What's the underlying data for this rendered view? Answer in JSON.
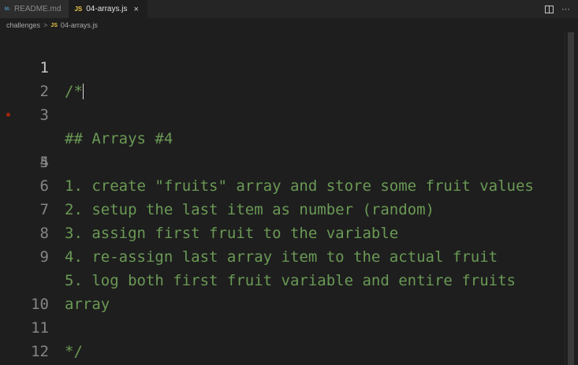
{
  "tabs": [
    {
      "label": "README.md",
      "icon": "markdown-icon",
      "icon_text": "M↓",
      "active": false
    },
    {
      "label": "04-arrays.js",
      "icon": "javascript-icon",
      "icon_text": "JS",
      "active": true,
      "close": "×"
    }
  ],
  "tab_actions": {
    "more": "···"
  },
  "breadcrumb": {
    "folder": "challenges",
    "separator": ">",
    "file_icon_text": "JS",
    "file": "04-arrays.js"
  },
  "editor": {
    "lines": [
      {
        "n": "1",
        "text": "/*"
      },
      {
        "n": "2",
        "text": ""
      },
      {
        "n": "3",
        "text": "## Arrays #4"
      },
      {
        "n": "4",
        "text": ""
      },
      {
        "n": "5",
        "text": "1. create \"fruits\" array and store some fruit values"
      },
      {
        "n": "6",
        "text": "2. setup the last item as number (random)"
      },
      {
        "n": "7",
        "text": "3. assign first fruit to the variable"
      },
      {
        "n": "8",
        "text": "4. re-assign last array item to the actual fruit"
      },
      {
        "n": "9",
        "text": "5. log both first fruit variable and entire fruits"
      },
      {
        "n": "",
        "text": "array"
      },
      {
        "n": "10",
        "text": ""
      },
      {
        "n": "11",
        "text": "*/"
      },
      {
        "n": "12",
        "text": ""
      }
    ]
  },
  "colors": {
    "background": "#1e1e1e",
    "comment": "#6a9955",
    "line_number": "#858585",
    "js_icon": "#e8c547"
  }
}
